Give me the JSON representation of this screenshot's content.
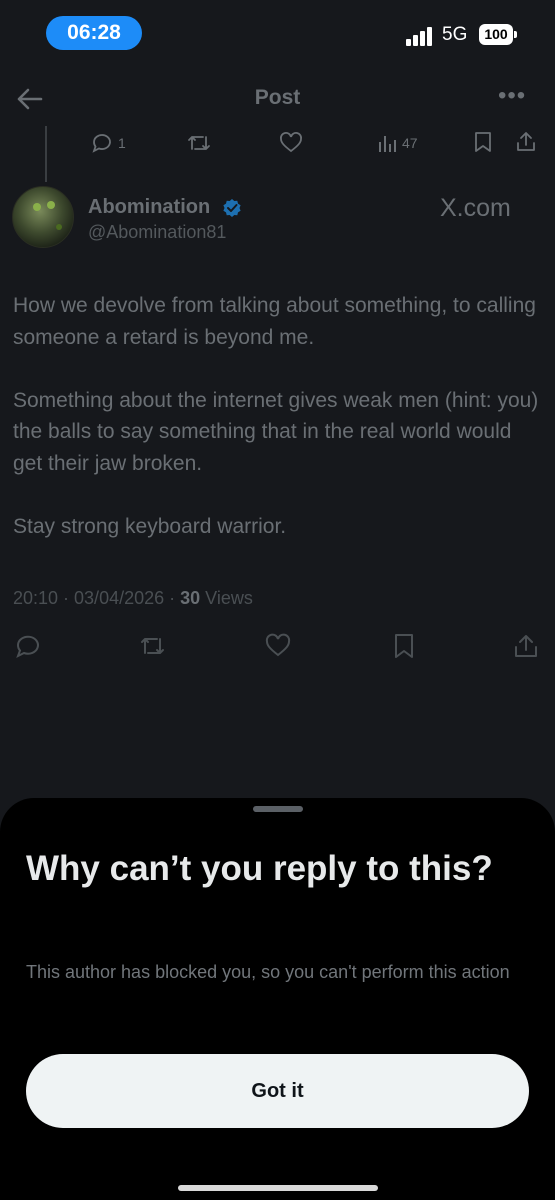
{
  "status_bar": {
    "time": "06:28",
    "network": "5G",
    "battery": "100"
  },
  "header": {
    "title": "Post"
  },
  "parent_actions": {
    "reply_count": "1",
    "views_count": "47"
  },
  "post": {
    "author_name": "Abomination",
    "author_handle": "@Abomination81",
    "source_label": "X.com",
    "paragraphs": [
      "How we devolve from talking about something, to calling someone a retard is beyond me.",
      "Something about the internet gives weak men (hint: you) the balls to say something that in the real world would get their jaw broken.",
      "Stay strong keyboard warrior."
    ],
    "timestamp": "20:10 · 03/04/2026 · ",
    "views_number": "30",
    "views_label": " Views"
  },
  "sheet": {
    "title": "Why can’t you reply to this?",
    "description": "This author has blocked you, so you can't perform this action",
    "button_label": "Got it"
  },
  "colors": {
    "accent": "#1d9bf0",
    "time_pill": "#1d8cf8",
    "button_bg": "#eff3f4"
  }
}
